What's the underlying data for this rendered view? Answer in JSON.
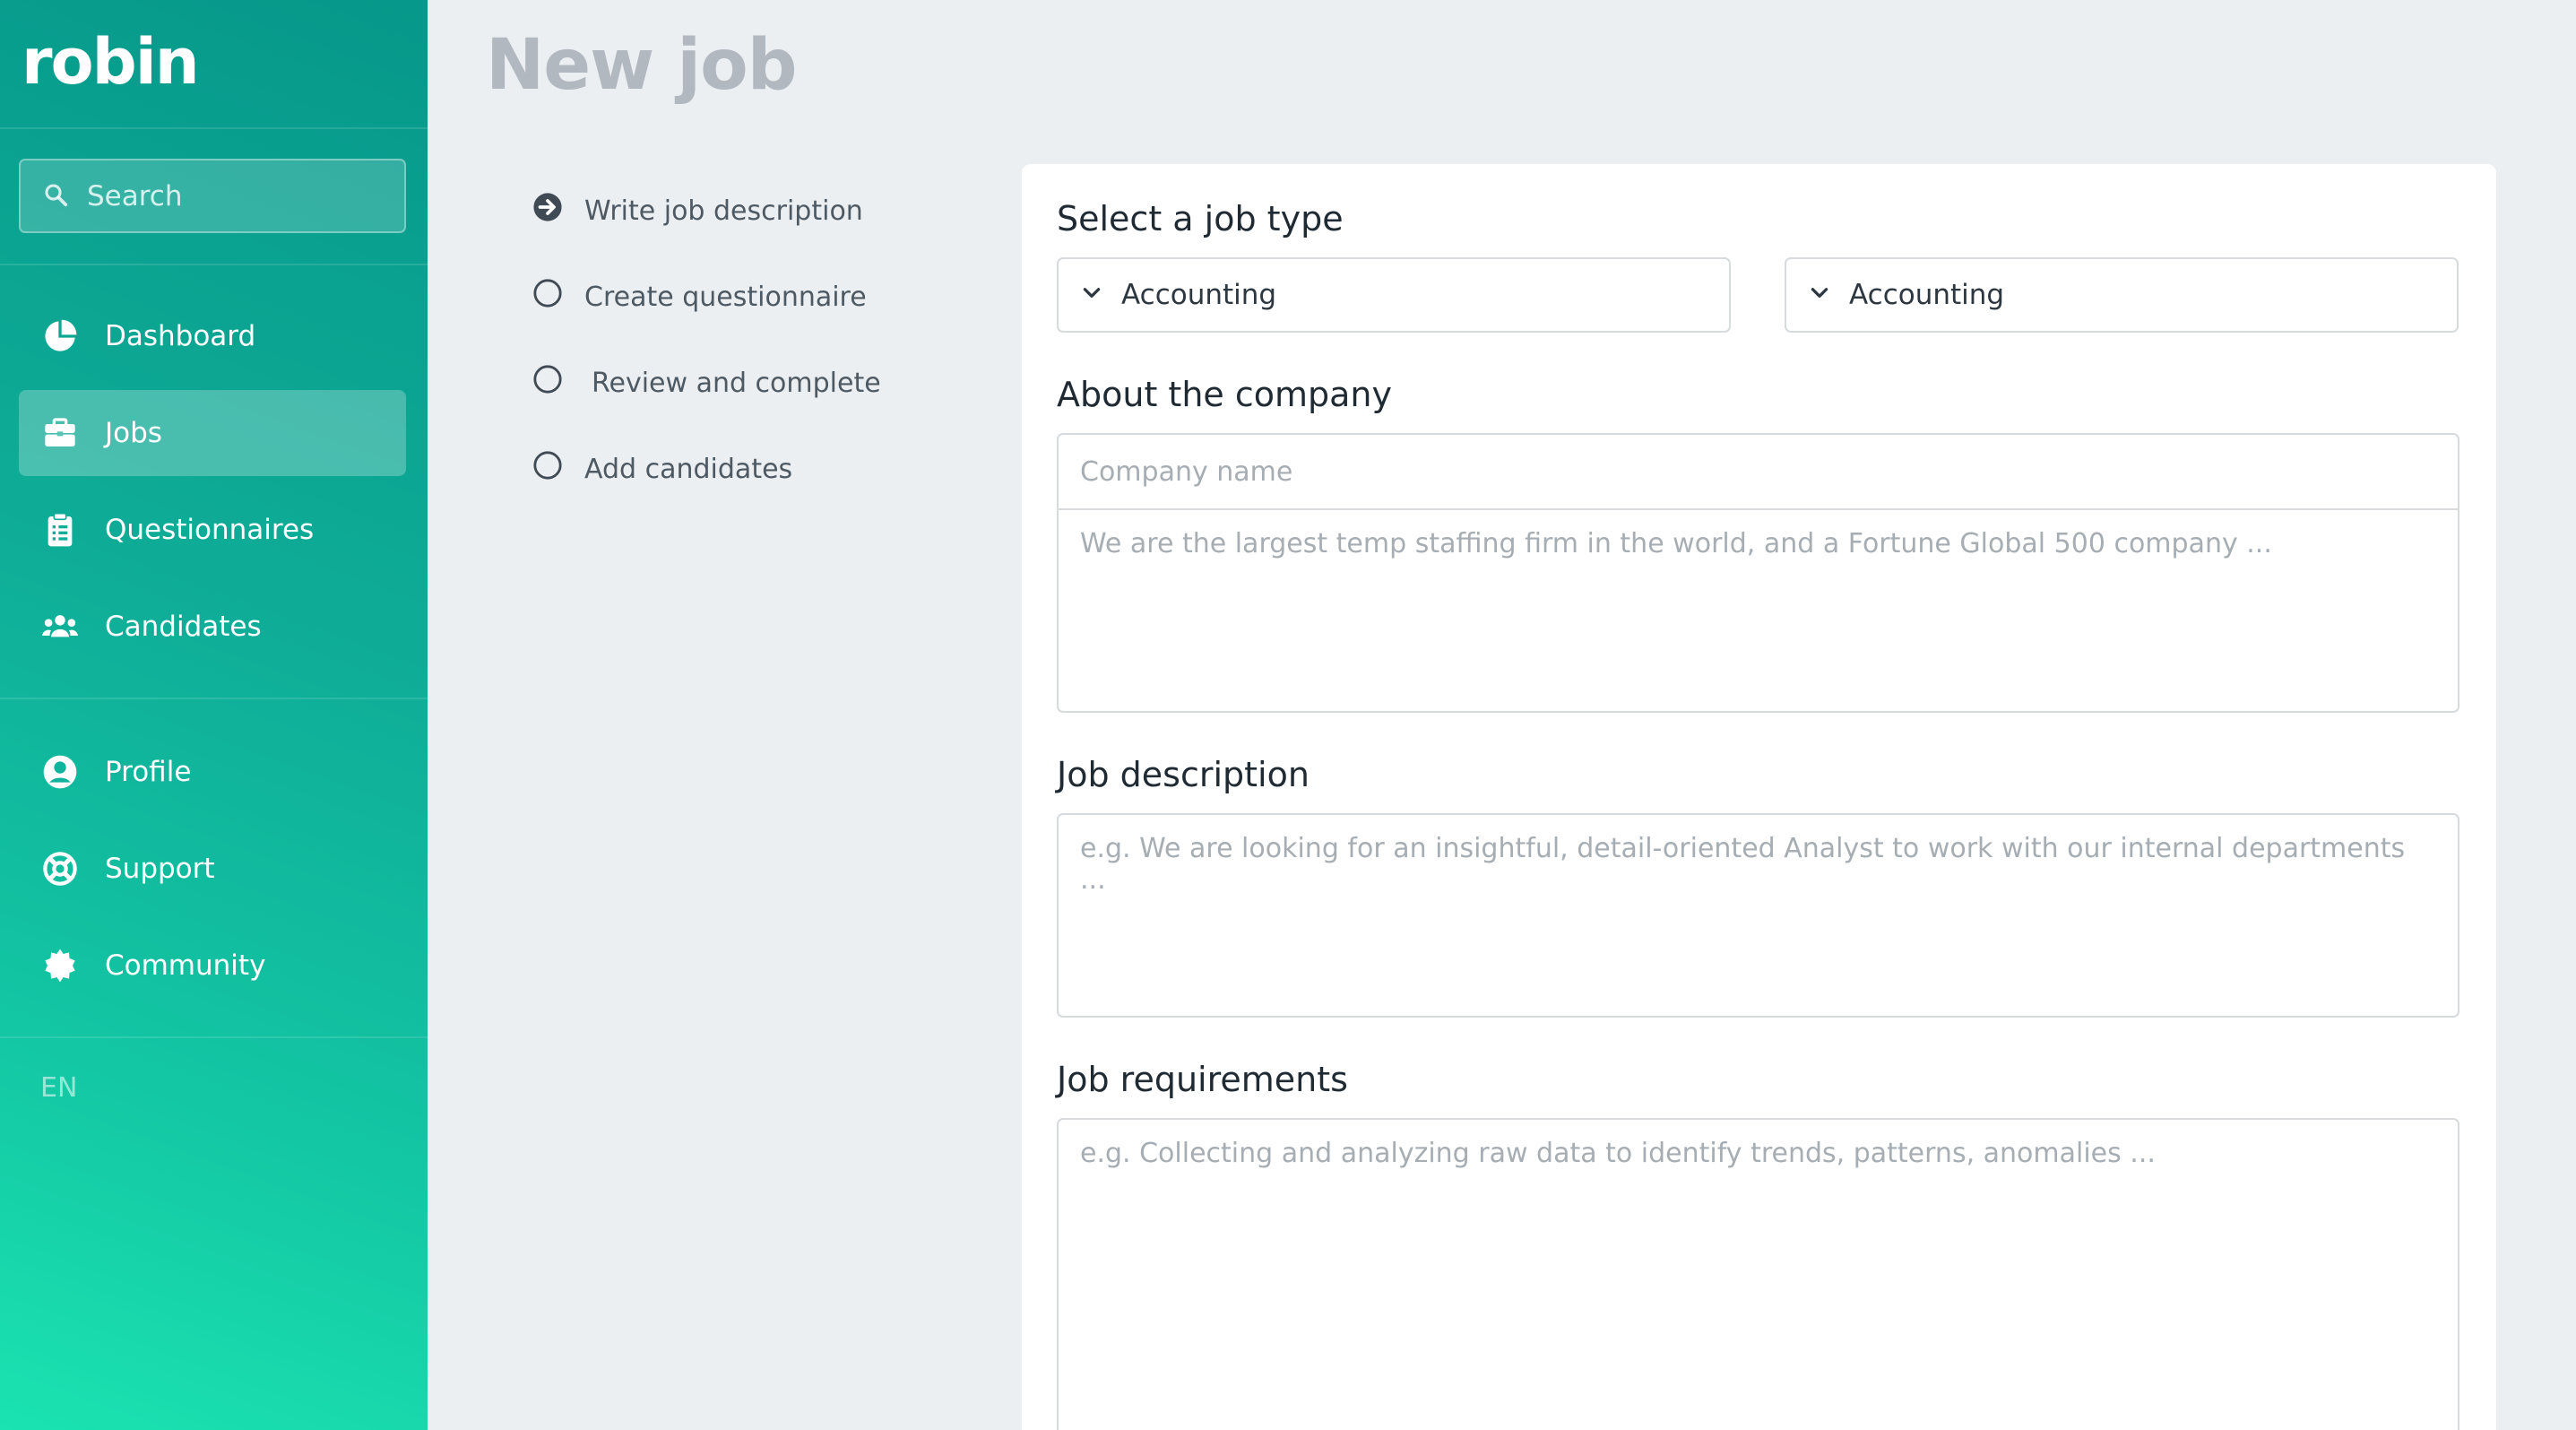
{
  "brand": {
    "logo_text": "robin"
  },
  "search": {
    "placeholder": "Search"
  },
  "nav": {
    "main": [
      {
        "label": "Dashboard",
        "icon": "pie-chart-icon"
      },
      {
        "label": "Jobs",
        "icon": "briefcase-icon",
        "active": true
      },
      {
        "label": "Questionnaires",
        "icon": "clipboard-icon"
      },
      {
        "label": "Candidates",
        "icon": "users-icon"
      }
    ],
    "secondary": [
      {
        "label": "Profile",
        "icon": "user-circle-icon"
      },
      {
        "label": "Support",
        "icon": "life-ring-icon"
      },
      {
        "label": "Community",
        "icon": "certificate-icon"
      }
    ],
    "language": "EN"
  },
  "page": {
    "title": "New job"
  },
  "steps": [
    {
      "label": "Write job description",
      "icon": "arrow-circle-right-icon",
      "current": true
    },
    {
      "label": "Create questionnaire",
      "icon": "circle-icon"
    },
    {
      "label": "Review and complete",
      "icon": "circle-icon"
    },
    {
      "label": "Add candidates",
      "icon": "circle-icon"
    }
  ],
  "form": {
    "job_type": {
      "label": "Select a job type",
      "primary_value": "Accounting",
      "secondary_value": "Accounting"
    },
    "company": {
      "label": "About the company",
      "name_placeholder": "Company name",
      "about_placeholder": "We are the largest temp staffing firm in the world, and a Fortune Global 500 company ..."
    },
    "description": {
      "label": "Job description",
      "placeholder": "e.g. We are looking for an insightful, detail-oriented Analyst to work with our internal departments ..."
    },
    "requirements": {
      "label": "Job requirements",
      "placeholder": "e.g. Collecting and analyzing raw data to identify trends, patterns, anomalies ..."
    }
  },
  "colors": {
    "sidebar_top": "#06988a",
    "sidebar_bottom": "#1be3b1",
    "background": "#eceff2",
    "title_gray": "#b1b8bf"
  }
}
